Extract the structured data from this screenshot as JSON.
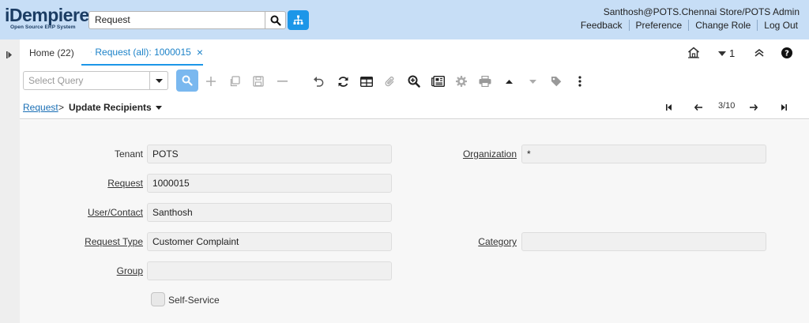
{
  "header": {
    "logo_main": "iDempiere",
    "logo_sub": "Open Source ERP System",
    "search_value": "Request",
    "user_info": "Santhosh@POTS.Chennai Store/POTS Admin",
    "links": [
      "Feedback",
      "Preference",
      "Change Role",
      "Log Out"
    ]
  },
  "tabs": {
    "home_label": "Home (22)",
    "active_label": "Request (all): 1000015",
    "close_glyph": "×",
    "window_count": "1"
  },
  "toolbar": {
    "query_placeholder": "Select Query"
  },
  "breadcrumb": {
    "parent": "Request",
    "separator": ">",
    "current": "Update Recipients",
    "record_position": "3/10"
  },
  "form": {
    "tenant": {
      "label": "Tenant",
      "value": "POTS"
    },
    "organization": {
      "label": "Organization",
      "value": "*"
    },
    "request": {
      "label": "Request",
      "value": "1000015"
    },
    "user_contact": {
      "label": "User/Contact",
      "value": "Santhosh"
    },
    "request_type": {
      "label": "Request Type",
      "value": "Customer Complaint"
    },
    "category": {
      "label": "Category",
      "value": ""
    },
    "group": {
      "label": "Group",
      "value": ""
    },
    "self_service": {
      "label": "Self-Service",
      "checked": false
    }
  },
  "colors": {
    "header_bg": "#c7def6",
    "accent": "#1c96e8",
    "primary_button": "#7ab8ef",
    "link": "#1a6fb5"
  }
}
